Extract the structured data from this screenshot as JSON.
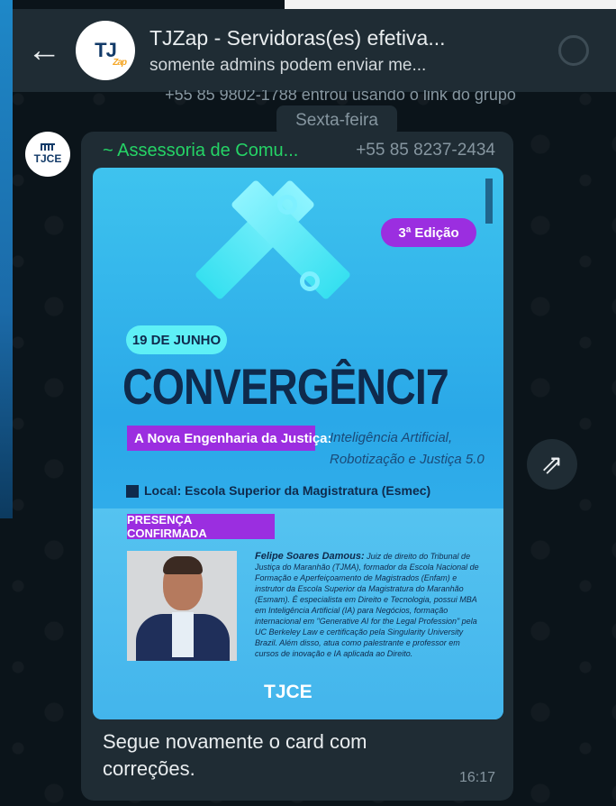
{
  "header": {
    "back_icon": "arrow-left-icon",
    "avatar_text": "TJ",
    "avatar_small": "Zap",
    "title": "TJZap - Servidoras(es) efetiva...",
    "subtitle": "somente admins podem enviar me..."
  },
  "system_message": "+55 85 9802-1788 entrou usando o link do grupo",
  "date_chip": "Sexta-feira",
  "message": {
    "sender_avatar_text": "TJCE",
    "sender_name": "~ Assessoria de Comu...",
    "sender_phone": "+55 85 8237-2434",
    "caption": "Segue novamente o card com correções.",
    "time": "16:17"
  },
  "card": {
    "edition": "3ª Edição",
    "date": "19 DE JUNHO",
    "title": "CONVERGÊNCI7",
    "subtitle_highlight": "A Nova Engenharia da Justiça:",
    "subtitle_rest": "Inteligência Artificial, Robotização e Justiça 5.0",
    "location": "Local: Escola Superior da Magistratura (Esmec)",
    "presence": "PRESENÇA CONFIRMADA",
    "speaker_name": "Felipe Soares Damous:",
    "speaker_bio": "Juiz de direito do Tribunal de Justiça do Maranhão (TJMA), formador da Escola Nacional de Formação e Aperfeiçoamento de Magistrados (Enfam) e instrutor da Escola Superior da Magistratura do Maranhão (Esmam). É especialista em Direito e Tecnologia, possui MBA em Inteligência Artificial (IA) para Negócios, formação internacional em \"Generative AI for the Legal Profession\" pela UC Berkeley Law e certificação pela Singularity University Brazil. Além disso, atua como palestrante e professor em cursos de inovação e IA aplicada ao Direito.",
    "footer_logo": "TJCE"
  },
  "forward_icon": "forward-icon"
}
